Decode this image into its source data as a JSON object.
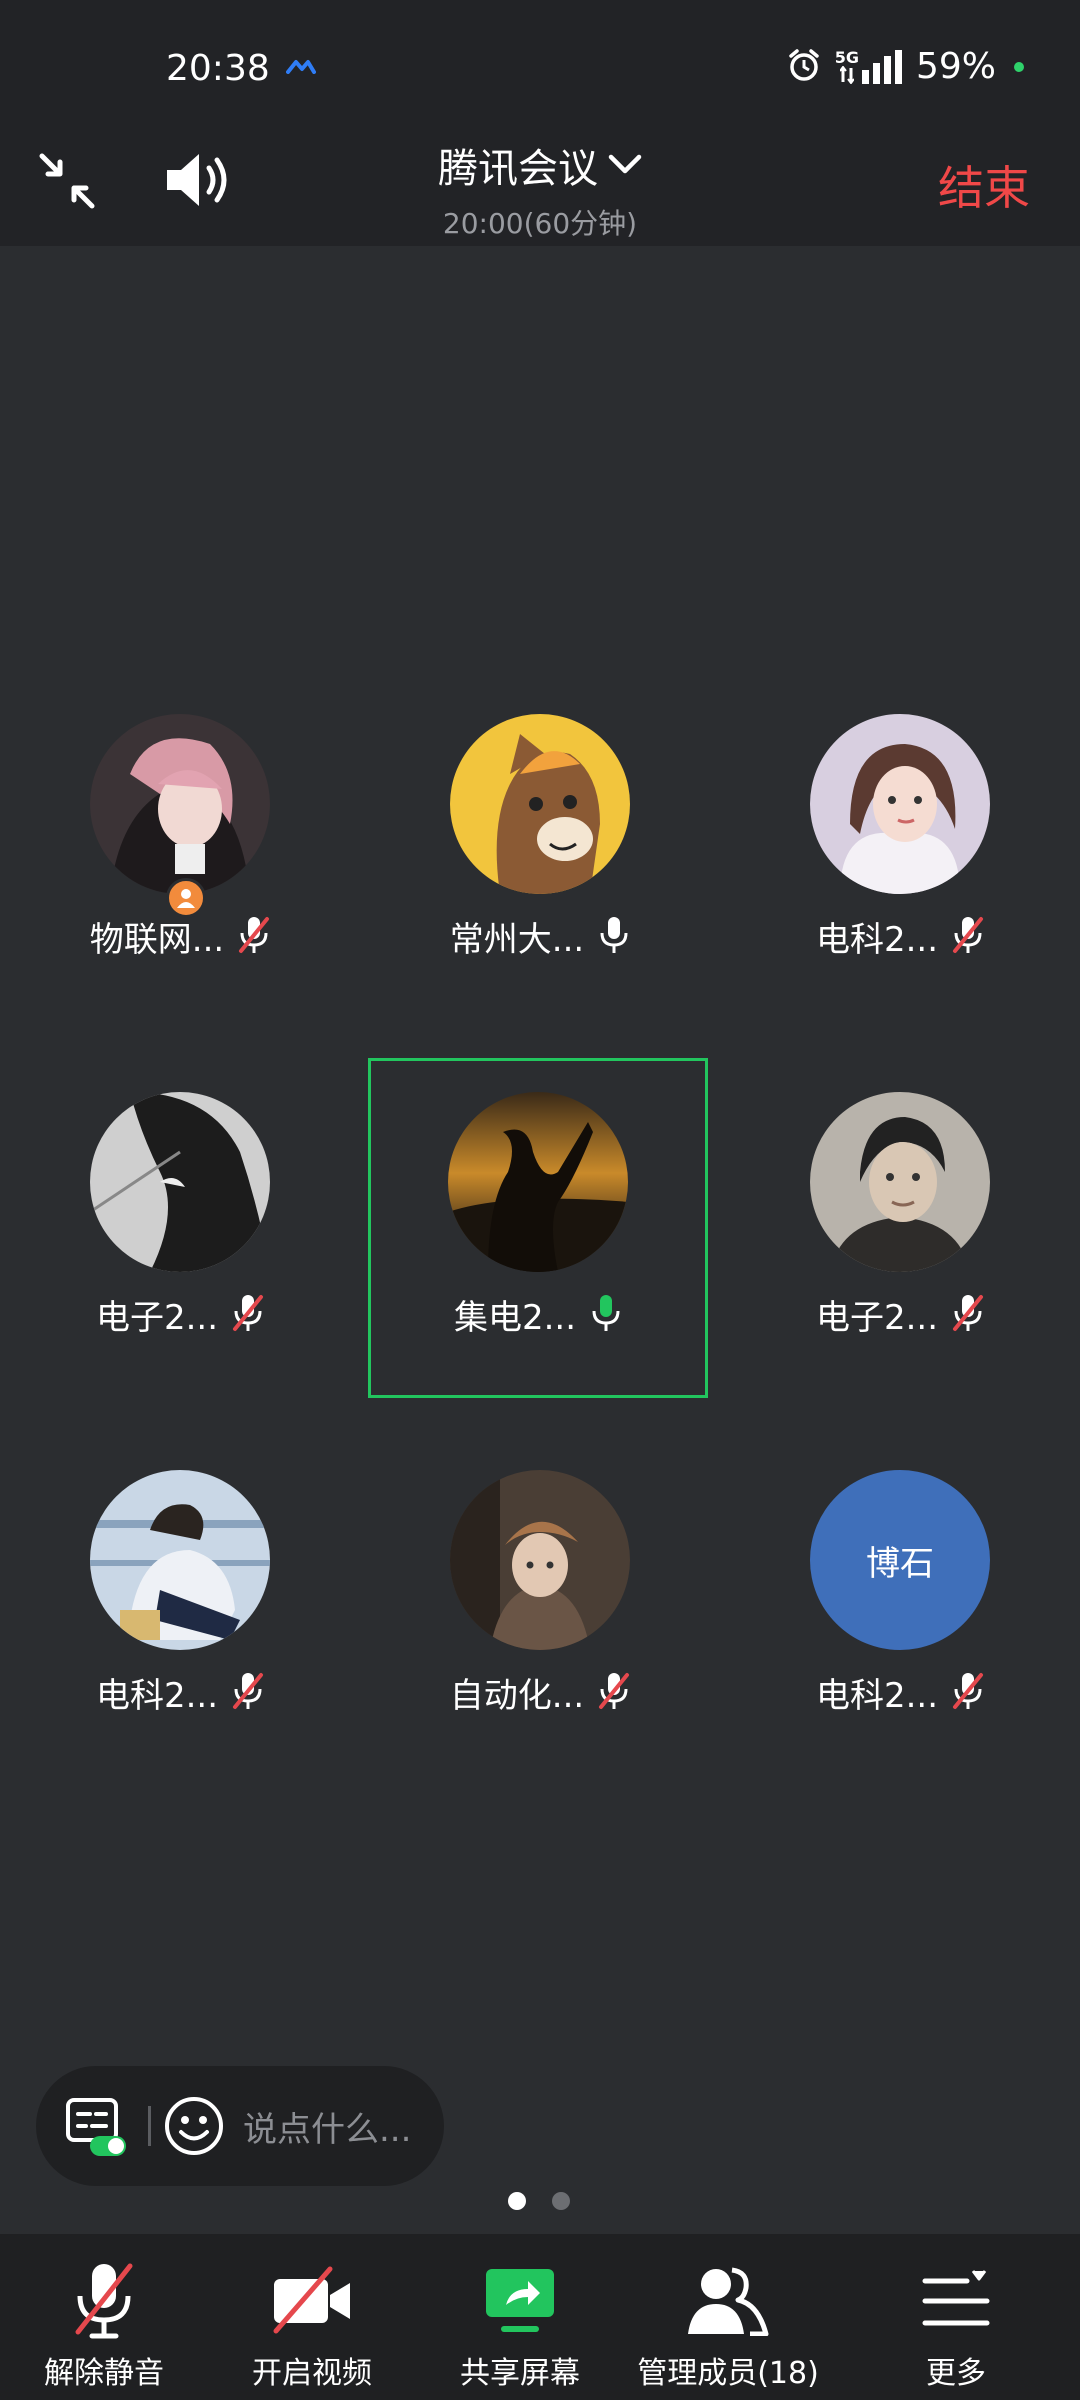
{
  "status_bar": {
    "time": "20:38",
    "network": "5G",
    "battery": "59%"
  },
  "header": {
    "title": "腾讯会议",
    "subtitle": "20:00(60分钟)",
    "end_label": "结束"
  },
  "participants": [
    {
      "name": "物联网...",
      "mic": "muted",
      "host": true
    },
    {
      "name": "常州大...",
      "mic": "on"
    },
    {
      "name": "电科2...",
      "mic": "muted"
    },
    {
      "name": "电子2...",
      "mic": "muted"
    },
    {
      "name": "集电2...",
      "mic": "speaking",
      "active": true
    },
    {
      "name": "电子2...",
      "mic": "muted"
    },
    {
      "name": "电科2...",
      "mic": "muted"
    },
    {
      "name": "自动化...",
      "mic": "muted"
    },
    {
      "name": "电科2...",
      "mic": "muted",
      "avatar_text": "博石"
    }
  ],
  "chat": {
    "placeholder": "说点什么..."
  },
  "pagination": {
    "pages": 2,
    "current": 1
  },
  "toolbar": {
    "unmute": "解除静音",
    "video": "开启视频",
    "share": "共享屏幕",
    "members": "管理成员(18)",
    "more": "更多"
  },
  "colors": {
    "background": "#2b2d30",
    "accent_green": "#22c55e",
    "end_red": "#f04848",
    "mute_red": "#e5484d"
  }
}
